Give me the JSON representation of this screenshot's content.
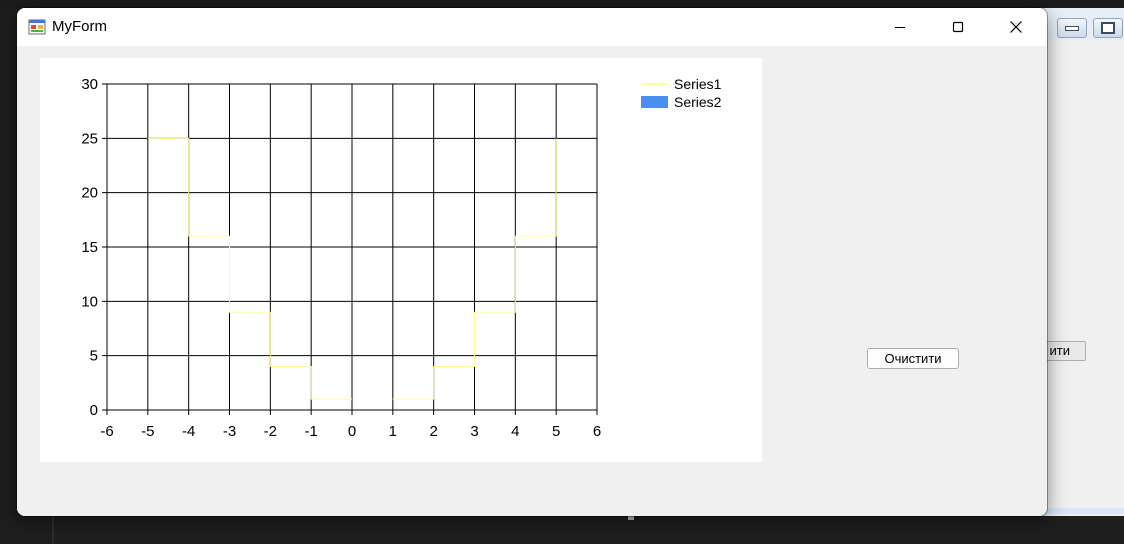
{
  "window": {
    "title": "MyForm",
    "clear_button_label": "Очистити"
  },
  "background_window": {
    "clear_button_label_fragment": "ити"
  },
  "colors": {
    "series1": "#ffff99",
    "series2": "#4a8ff0",
    "grid": "#000000"
  },
  "chart_data": {
    "type": "line",
    "xlim": [
      -6,
      6
    ],
    "ylim": [
      0,
      30
    ],
    "x_ticks": [
      -6,
      -5,
      -4,
      -3,
      -2,
      -1,
      0,
      1,
      2,
      3,
      4,
      5,
      6
    ],
    "y_ticks": [
      0,
      5,
      10,
      15,
      20,
      25,
      30
    ],
    "grid": true,
    "legend_position": "top-right",
    "series": [
      {
        "name": "Series1",
        "style": "step",
        "segments": [
          [
            [
              -5,
              25
            ],
            [
              -4,
              25
            ],
            [
              -4,
              16
            ],
            [
              -3,
              16
            ],
            [
              -3,
              9
            ],
            [
              -2,
              9
            ],
            [
              -2,
              4
            ],
            [
              -1,
              4
            ],
            [
              -1,
              1
            ],
            [
              0,
              1
            ]
          ],
          [
            [
              1,
              1
            ],
            [
              2,
              1
            ],
            [
              2,
              4
            ],
            [
              3,
              4
            ],
            [
              3,
              9
            ],
            [
              4,
              9
            ],
            [
              4,
              16
            ],
            [
              5,
              16
            ],
            [
              5,
              25
            ]
          ]
        ]
      },
      {
        "name": "Series2",
        "style": "bar",
        "segments": []
      }
    ]
  }
}
